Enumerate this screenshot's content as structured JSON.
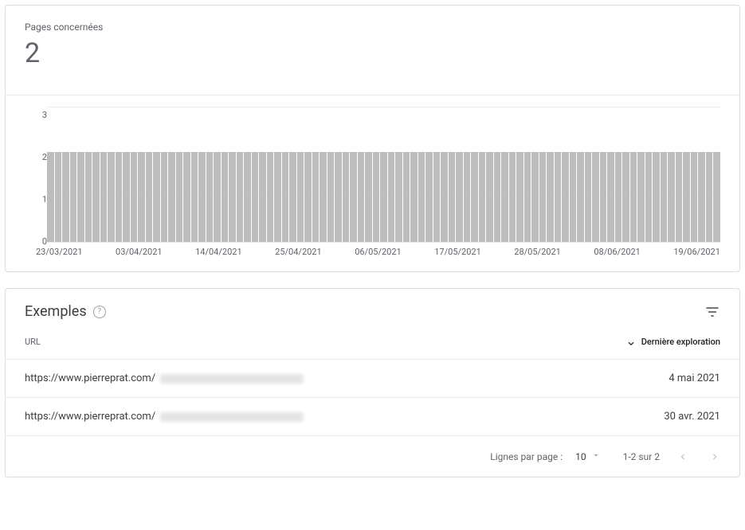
{
  "summary": {
    "label": "Pages concernées",
    "value": "2"
  },
  "chart_data": {
    "type": "bar",
    "title": "",
    "xlabel": "",
    "ylabel": "",
    "ylim": [
      0,
      3
    ],
    "y_ticks": [
      "3",
      "2",
      "1",
      "0"
    ],
    "x_ticks": [
      "23/03/2021",
      "03/04/2021",
      "14/04/2021",
      "25/04/2021",
      "06/05/2021",
      "17/05/2021",
      "28/05/2021",
      "08/06/2021",
      "19/06/2021"
    ],
    "categories_range": {
      "start": "23/03/2021",
      "end": "19/06/2021",
      "count": 89
    },
    "uniform_value": 2
  },
  "examples": {
    "title": "Exemples",
    "columns": {
      "url": "URL",
      "last_crawl": "Dernière exploration"
    },
    "rows": [
      {
        "url_prefix": "https://www.pierreprat.com/",
        "url_rest_redacted": true,
        "last_crawl": "4 mai 2021"
      },
      {
        "url_prefix": "https://www.pierreprat.com/",
        "url_rest_redacted": true,
        "last_crawl": "30 avr. 2021"
      }
    ]
  },
  "pagination": {
    "rows_per_page_label": "Lignes par page :",
    "rows_per_page_value": "10",
    "range_text": "1-2 sur 2"
  }
}
